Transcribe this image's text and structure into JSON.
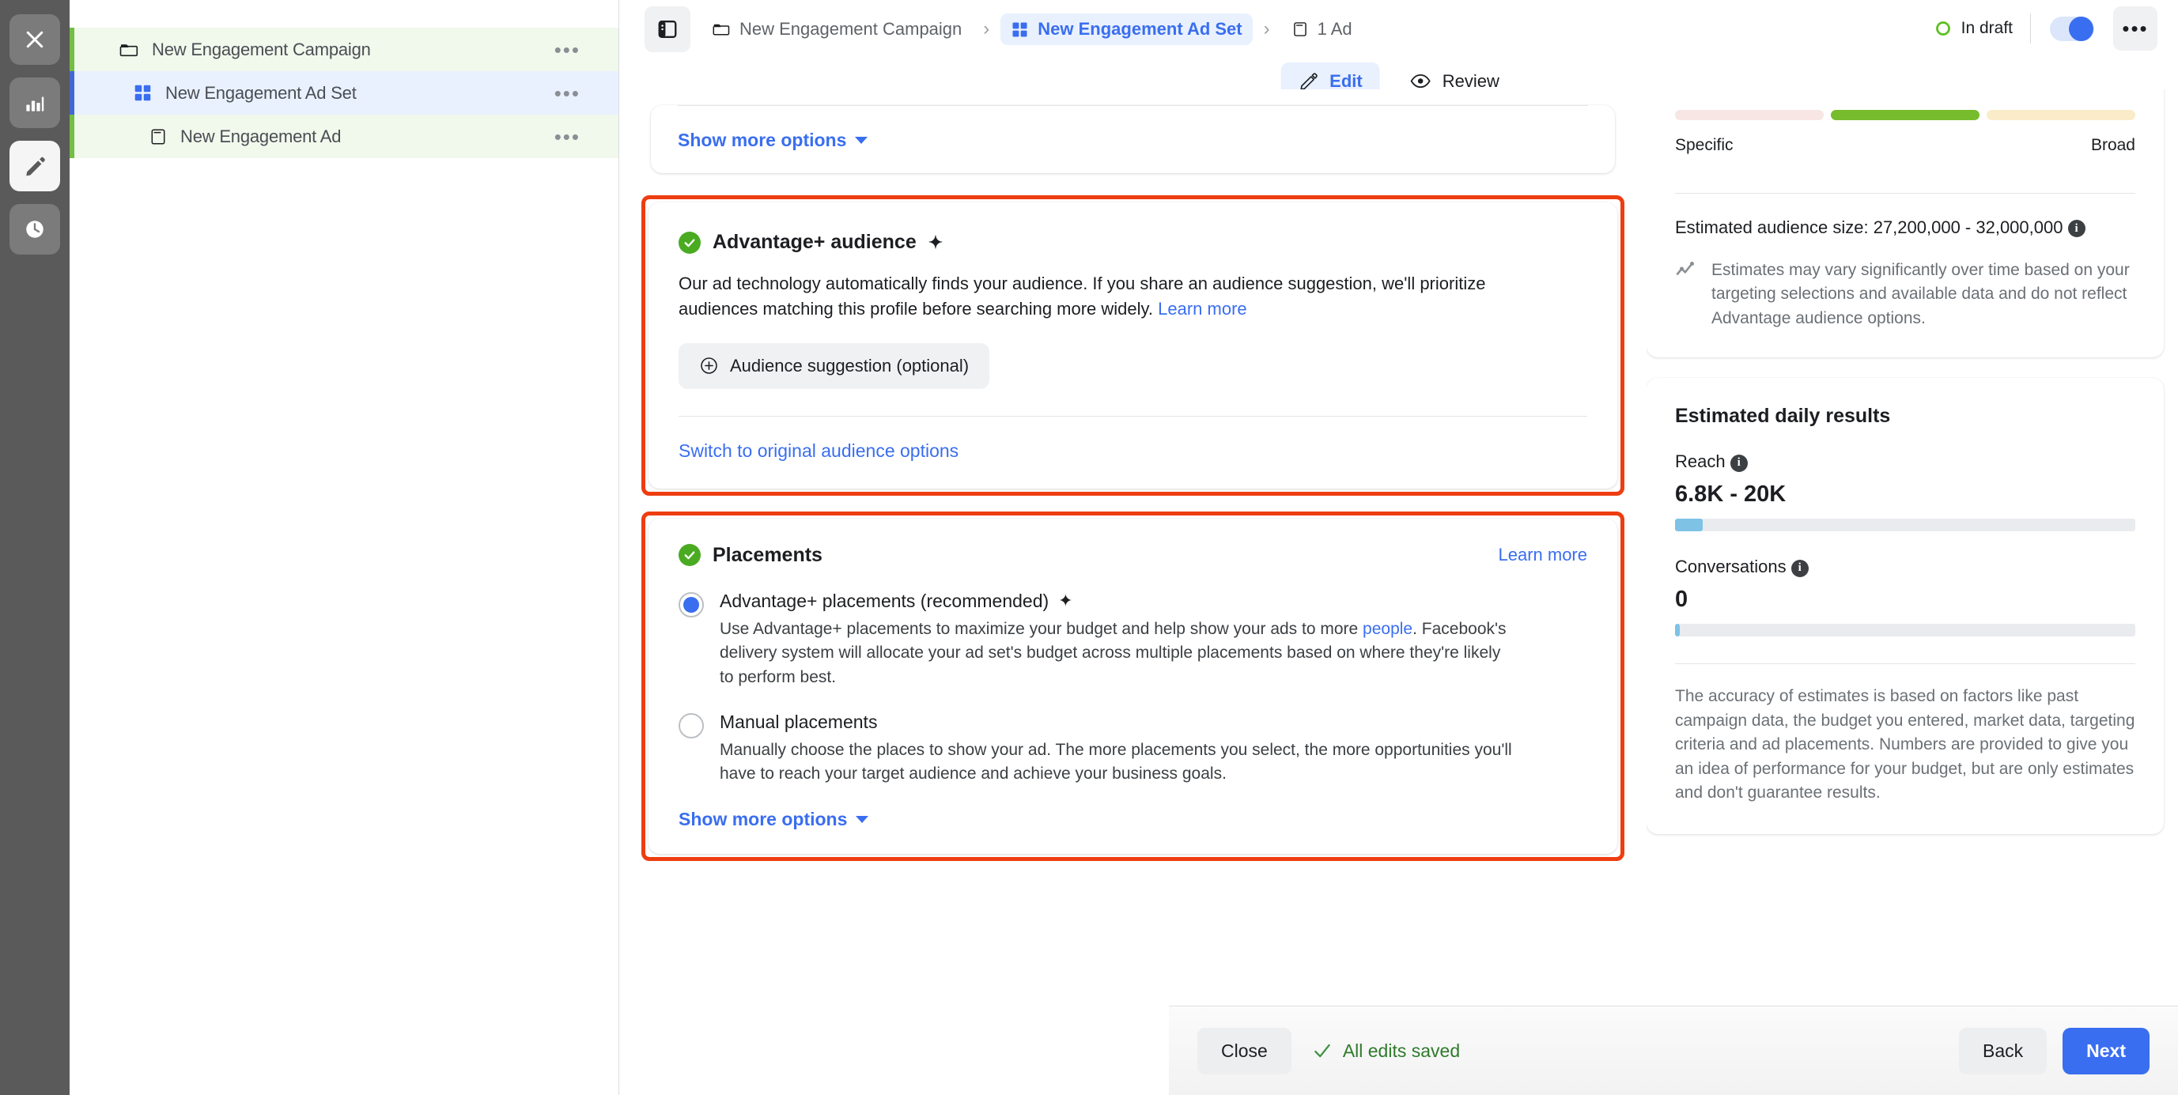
{
  "rail": {
    "items": [
      {
        "name": "close-icon",
        "label": "Close",
        "active": false
      },
      {
        "name": "chart-icon",
        "label": "Reporting",
        "active": false
      },
      {
        "name": "pencil-icon",
        "label": "Edit",
        "active": true
      },
      {
        "name": "clock-icon",
        "label": "History",
        "active": false
      }
    ]
  },
  "sidebar": {
    "items": [
      {
        "label": "New Engagement Campaign",
        "icon": "folder-icon",
        "level": 0,
        "state": "campaign"
      },
      {
        "label": "New Engagement Ad Set",
        "icon": "grid-icon",
        "level": 1,
        "state": "adset"
      },
      {
        "label": "New Engagement Ad",
        "icon": "ad-icon",
        "level": 2,
        "state": "ad"
      }
    ],
    "menu_glyph": "•••"
  },
  "topbar": {
    "panel_toggle_icon": "panel-toggle-icon",
    "breadcrumbs": [
      {
        "label": "New Engagement Campaign",
        "icon": "folder-icon",
        "active": false
      },
      {
        "label": "New Engagement Ad Set",
        "icon": "grid-icon",
        "active": true
      },
      {
        "label": "1 Ad",
        "icon": "ad-icon",
        "active": false
      }
    ],
    "separator": "›",
    "status_label": "In draft",
    "status_color": "#5bbf21",
    "toggle_on": true,
    "more_glyph": "•••",
    "modes": [
      {
        "label": "Edit",
        "icon": "pencil-icon",
        "active": true
      },
      {
        "label": "Review",
        "icon": "eye-icon",
        "active": false
      }
    ]
  },
  "audience_network_card": {
    "show_more_label": "Show more options"
  },
  "advantage_audience": {
    "title": "Advantage+ audience",
    "sparkle": "✦",
    "description": "Our ad technology automatically finds your audience. If you share an audience suggestion, we'll prioritize audiences matching this profile before searching more widely.",
    "learn_more": "Learn more",
    "suggestion_button": "Audience suggestion (optional)",
    "suggestion_icon": "plus-circle-icon",
    "switch_link": "Switch to original audience options",
    "highlighted": true
  },
  "placements": {
    "title": "Placements",
    "learn_more": "Learn more",
    "options": [
      {
        "label": "Advantage+ placements (recommended)",
        "sparkle": "✦",
        "selected": true,
        "desc_before": "Use Advantage+ placements to maximize your budget and help show your ads to more ",
        "desc_link": "people",
        "desc_after": ". Facebook's delivery system will allocate your ad set's budget across multiple placements based on where they're likely to perform best."
      },
      {
        "label": "Manual placements",
        "sparkle": "",
        "selected": false,
        "desc_before": "Manually choose the places to show your ad. The more placements you select, the more opportunities you'll have to reach your target audience and achieve your business goals.",
        "desc_link": "",
        "desc_after": ""
      }
    ],
    "show_more_label": "Show more options",
    "highlighted": true
  },
  "estimates": {
    "meter_left_label": "Specific",
    "meter_right_label": "Broad",
    "audience_size_label": "Estimated audience size:",
    "audience_size_value": "27,200,000 - 32,000,000",
    "note_icon": "trend-chart-icon",
    "note": "Estimates may vary significantly over time based on your targeting selections and available data and do not reflect Advantage audience options."
  },
  "daily_results": {
    "title": "Estimated daily results",
    "metrics": [
      {
        "label": "Reach",
        "value": "6.8K - 20K",
        "bar_percent": 6
      },
      {
        "label": "Conversations",
        "value": "0",
        "bar_percent": 1
      }
    ],
    "disclaimer": "The accuracy of estimates is based on factors like past campaign data, the budget you entered, market data, targeting criteria and ad placements. Numbers are provided to give you an idea of performance for your budget, but are only estimates and don't guarantee results."
  },
  "footer": {
    "close_label": "Close",
    "saved_label": "All edits saved",
    "saved_icon": "check-icon",
    "back_label": "Back",
    "next_label": "Next"
  },
  "colors": {
    "accent_blue": "#3a6ef0",
    "green": "#4aab22",
    "highlight_red": "#ee3d11",
    "bar_blue": "#7ec2e6"
  }
}
